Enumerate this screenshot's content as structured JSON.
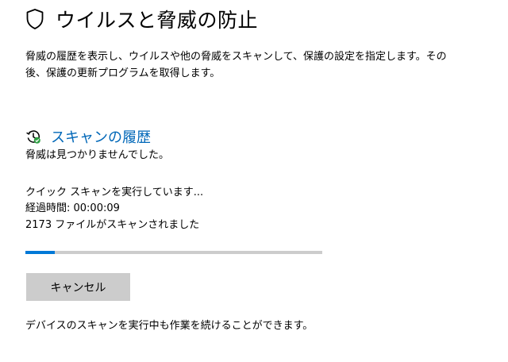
{
  "header": {
    "icon": "shield-icon",
    "title": "ウイルスと脅威の防止"
  },
  "description": "脅威の履歴を表示し、ウイルスや他の脅威をスキャンして、保護の設定を指定します。その後、保護の更新プログラムを取得します。",
  "scan_history": {
    "icon": "history-clock-icon",
    "title": "スキャンの履歴",
    "status": "脅威は見つかりませんでした。"
  },
  "scan_progress": {
    "running_text": "クイック スキャンを実行しています...",
    "elapsed_label": "経過時間: 00:00:09",
    "files_scanned": "2173 ファイルがスキャンされました",
    "progress_fraction": 0.1
  },
  "cancel_button": {
    "label": "キャンセル"
  },
  "footer_note": "デバイスのスキャンを実行中も作業を続けることができます。",
  "colors": {
    "accent": "#0067b8",
    "progress": "#0078d7",
    "progress_track": "#cccccc",
    "history_badge": "#2ea043"
  }
}
